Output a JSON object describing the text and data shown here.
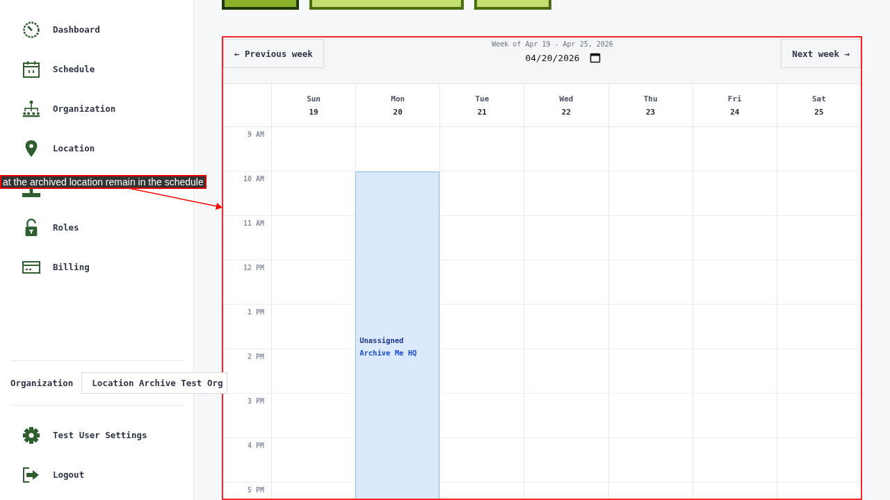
{
  "toolbar_buttons": [
    {
      "kind": "dark"
    },
    {
      "kind": "wide"
    },
    {
      "kind": "light"
    }
  ],
  "sidebar": {
    "items": [
      {
        "kind": "labelled",
        "label": "Dashboard"
      },
      {
        "kind": "labelled",
        "label": "Schedule"
      },
      {
        "kind": "labelled",
        "label": "Organization"
      },
      {
        "kind": "labelled",
        "label": "Location"
      },
      {
        "kind": "covered"
      },
      {
        "kind": "labelled",
        "label": "Roles"
      },
      {
        "kind": "labelled",
        "label": "Billing"
      }
    ],
    "organization": {
      "label": "Organization",
      "value": "Location Archive Test Org"
    },
    "footer_items": [
      {
        "label": "Test User Settings"
      },
      {
        "label": "Logout"
      }
    ]
  },
  "calendar": {
    "previous": "← Previous week",
    "next": "Next week →",
    "week_title": "Week of Apr 19 - Apr 25, 2026",
    "date": "04/20/2026",
    "days": [
      {
        "name": "Sun",
        "date": "19"
      },
      {
        "name": "Mon",
        "date": "20",
        "events": [
          {
            "title": "Unassigned",
            "location": "Archive Me HQ"
          }
        ]
      },
      {
        "name": "Tue",
        "date": "21"
      },
      {
        "name": "Wed",
        "date": "22"
      },
      {
        "name": "Thu",
        "date": "23"
      },
      {
        "name": "Fri",
        "date": "24"
      },
      {
        "name": "Sat",
        "date": "25"
      }
    ],
    "hours": [
      "9 AM",
      "10 AM",
      "11 AM",
      "12 PM",
      "1 PM",
      "2 PM",
      "3 PM",
      "4 PM",
      "5 PM"
    ]
  },
  "annotation": {
    "text": "at the archived location remain in the schedule"
  }
}
